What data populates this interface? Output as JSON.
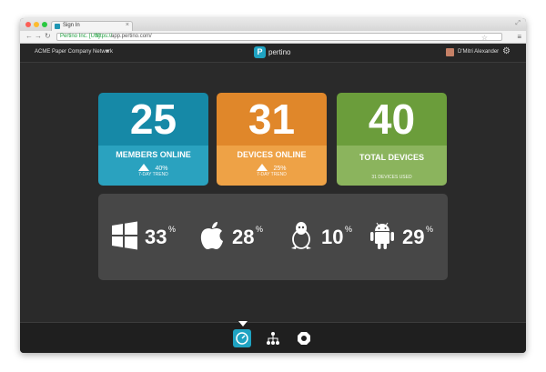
{
  "browser": {
    "tab_title": "Sign In",
    "ssl_label": "Pertino Inc. [US]",
    "url_scheme": "https://",
    "url": "app.pertino.com/"
  },
  "header": {
    "network_name": "ACME Paper Company Network",
    "logo_text": "pertino",
    "logo_mark": "P",
    "user_name": "D'Mitri Alexander"
  },
  "tiles": [
    {
      "number": "25",
      "label": "MEMBERS ONLINE",
      "trend": "40%",
      "trend_note": "7-DAY TREND",
      "color": "#1689a7"
    },
    {
      "number": "31",
      "label": "DEVICES ONLINE",
      "trend": "25%",
      "trend_note": "7-DAY TREND",
      "color": "#e0872a"
    },
    {
      "number": "40",
      "label": "TOTAL DEVICES",
      "sub": "31 DEVICES USED",
      "color": "#6b9d3b"
    }
  ],
  "os_stats": [
    {
      "icon": "windows-icon",
      "value": "33",
      "unit": "%"
    },
    {
      "icon": "apple-icon",
      "value": "28",
      "unit": "%"
    },
    {
      "icon": "linux-icon",
      "value": "10",
      "unit": "%"
    },
    {
      "icon": "android-icon",
      "value": "29",
      "unit": "%"
    }
  ],
  "colors": {
    "accent": "#1fa3c2",
    "background": "#2a2a2a",
    "panel": "#474747"
  }
}
